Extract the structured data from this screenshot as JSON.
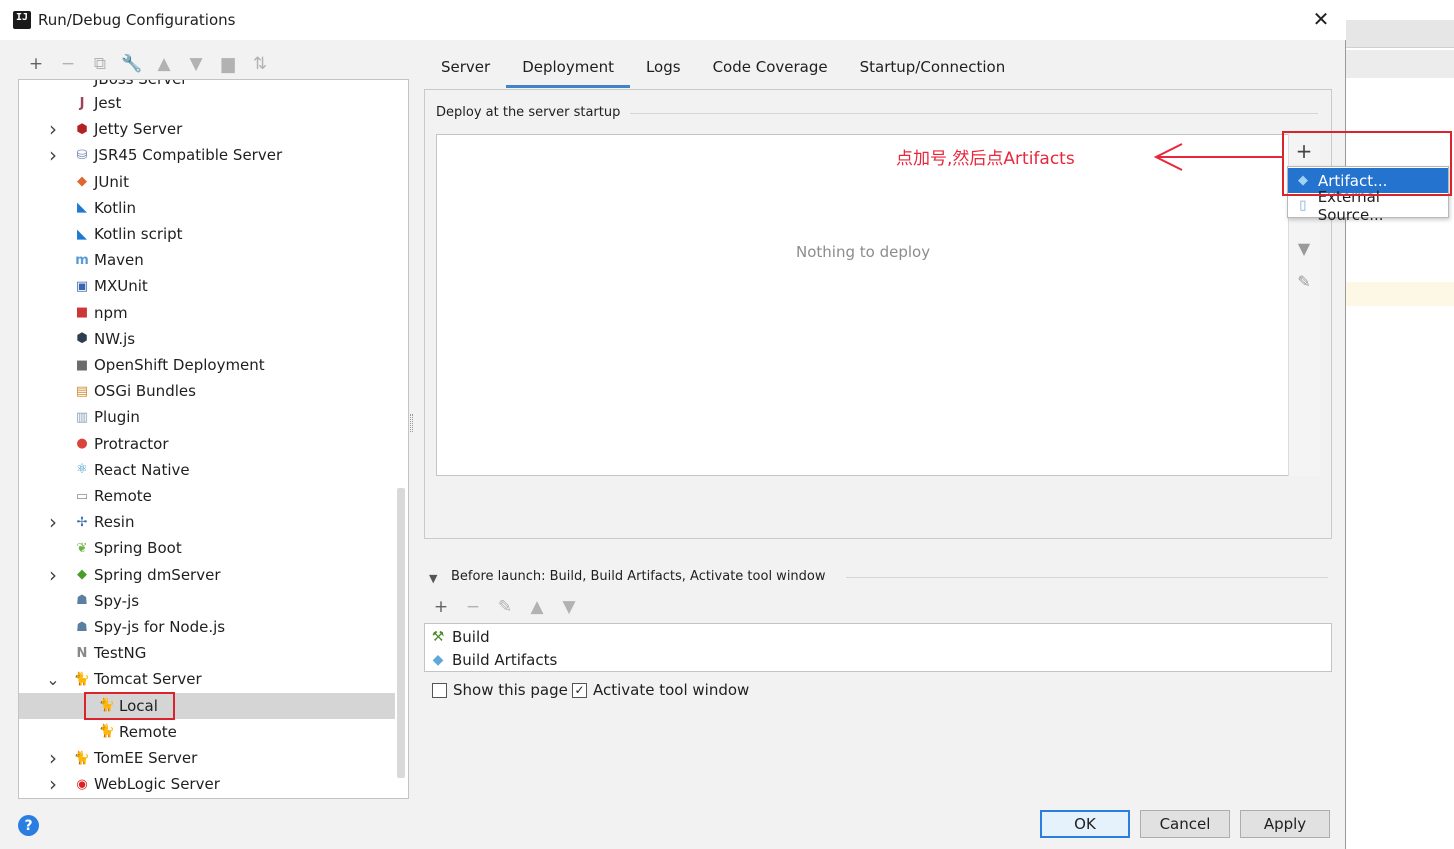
{
  "window": {
    "title": "Run/Debug Configurations",
    "close_glyph": "✕"
  },
  "left_toolbar": {
    "buttons": [
      "add-icon",
      "remove-icon",
      "copy-icon",
      "wrench-icon",
      "move-up-icon",
      "move-down-icon",
      "folder-icon",
      "sort-icon"
    ]
  },
  "tree": {
    "partial_top": "JBoss Server",
    "items": [
      {
        "label": "Jest",
        "icon": "jest-icon",
        "expandable": false
      },
      {
        "label": "Jetty Server",
        "icon": "jetty-icon",
        "expandable": true
      },
      {
        "label": "JSR45 Compatible Server",
        "icon": "jsr45-icon",
        "expandable": true
      },
      {
        "label": "JUnit",
        "icon": "junit-icon",
        "expandable": false
      },
      {
        "label": "Kotlin",
        "icon": "kotlin-icon",
        "expandable": false
      },
      {
        "label": "Kotlin script",
        "icon": "kotlin-script-icon",
        "expandable": false
      },
      {
        "label": "Maven",
        "icon": "maven-icon",
        "expandable": false
      },
      {
        "label": "MXUnit",
        "icon": "mxunit-icon",
        "expandable": false
      },
      {
        "label": "npm",
        "icon": "npm-icon",
        "expandable": false
      },
      {
        "label": "NW.js",
        "icon": "nwjs-icon",
        "expandable": false
      },
      {
        "label": "OpenShift Deployment",
        "icon": "openshift-icon",
        "expandable": false
      },
      {
        "label": "OSGi Bundles",
        "icon": "osgi-icon",
        "expandable": false
      },
      {
        "label": "Plugin",
        "icon": "plugin-icon",
        "expandable": false
      },
      {
        "label": "Protractor",
        "icon": "protractor-icon",
        "expandable": false
      },
      {
        "label": "React Native",
        "icon": "react-icon",
        "expandable": false
      },
      {
        "label": "Remote",
        "icon": "remote-icon",
        "expandable": false
      },
      {
        "label": "Resin",
        "icon": "resin-icon",
        "expandable": true
      },
      {
        "label": "Spring Boot",
        "icon": "spring-boot-icon",
        "expandable": false
      },
      {
        "label": "Spring dmServer",
        "icon": "spring-dm-icon",
        "expandable": true
      },
      {
        "label": "Spy-js",
        "icon": "spy-js-icon",
        "expandable": false
      },
      {
        "label": "Spy-js for Node.js",
        "icon": "spy-js-node-icon",
        "expandable": false
      },
      {
        "label": "TestNG",
        "icon": "testng-icon",
        "expandable": false
      },
      {
        "label": "Tomcat Server",
        "icon": "tomcat-icon",
        "expandable": true,
        "expanded": true
      },
      {
        "label": "Local",
        "icon": "tomcat-icon",
        "child": true,
        "selected": true
      },
      {
        "label": "Remote",
        "icon": "tomcat-icon",
        "child": true
      },
      {
        "label": "TomEE Server",
        "icon": "tomee-icon",
        "expandable": true
      },
      {
        "label": "WebLogic Server",
        "icon": "weblogic-icon",
        "expandable": true
      }
    ]
  },
  "tabs": [
    "Server",
    "Deployment",
    "Logs",
    "Code Coverage",
    "Startup/Connection"
  ],
  "active_tab": "Deployment",
  "deployment": {
    "header": "Deploy at the server startup",
    "empty_text": "Nothing to deploy",
    "annotation": "点加号,然后点Artifacts"
  },
  "popup_menu": {
    "items": [
      {
        "label": "Artifact...",
        "icon": "artifact-icon",
        "selected": true
      },
      {
        "label": "External Source...",
        "icon": "external-source-icon",
        "selected": false
      }
    ]
  },
  "before_launch": {
    "title": "Before launch: Build, Build Artifacts, Activate tool window",
    "items": [
      {
        "label": "Build",
        "icon": "hammer-icon"
      },
      {
        "label": "Build Artifacts",
        "icon": "artifact-icon"
      }
    ]
  },
  "options": {
    "show_page_label": "Show this page",
    "show_page_checked": false,
    "activate_label": "Activate tool window",
    "activate_checked": true
  },
  "buttons": {
    "ok": "OK",
    "cancel": "Cancel",
    "apply": "Apply",
    "help": "?"
  },
  "colors": {
    "accent": "#2473cf",
    "annotation": "#e8263c",
    "selection": "#d5d5d5"
  }
}
